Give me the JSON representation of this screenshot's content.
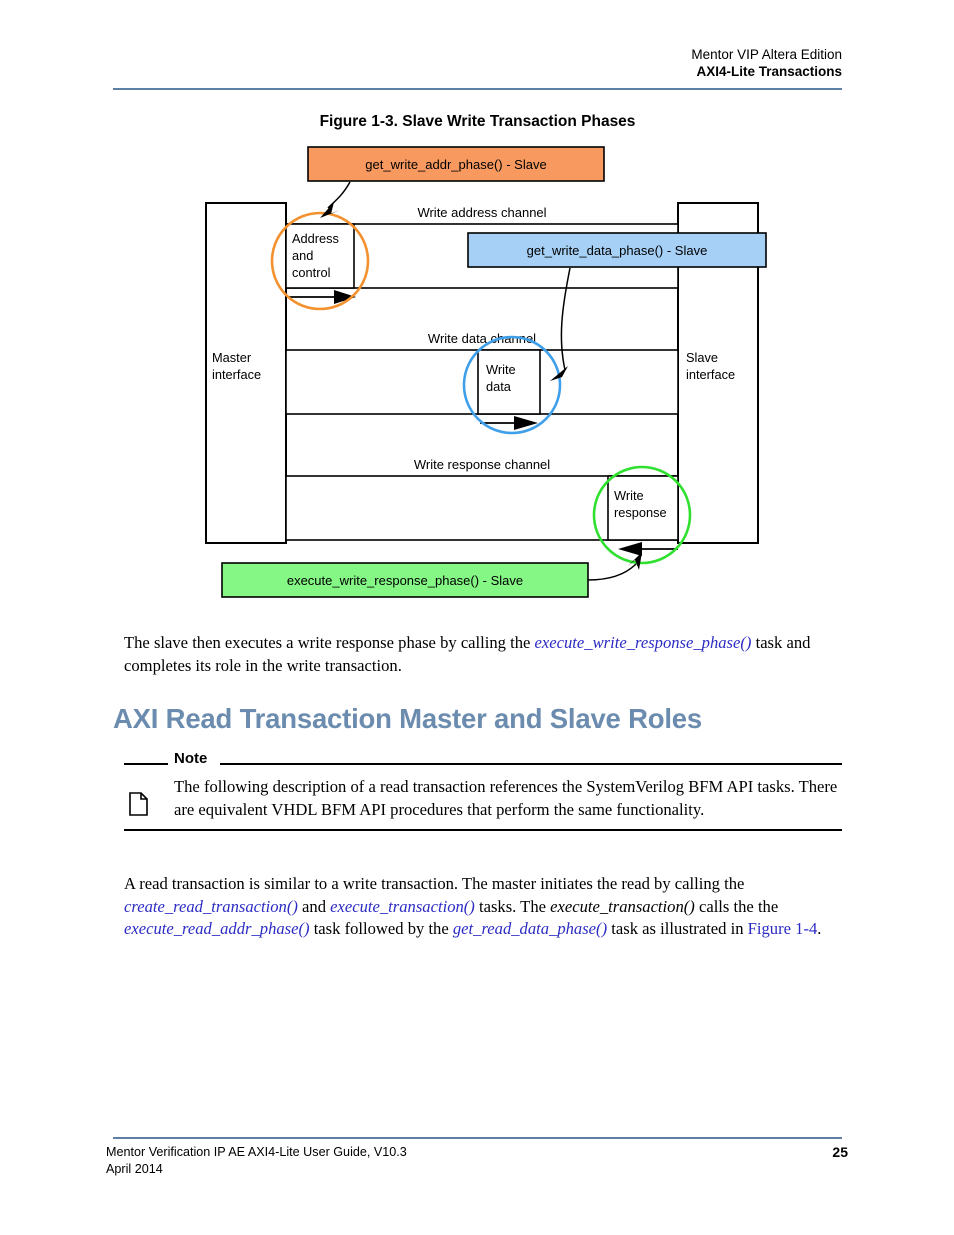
{
  "header": {
    "line1": "Mentor VIP Altera Edition",
    "line2": "AXI4-Lite Transactions",
    "rule_color": "#5c7fa3"
  },
  "figure": {
    "caption": "Figure 1-3. Slave Write Transaction Phases",
    "callouts": [
      {
        "id": "get-write-addr-phase",
        "label": "get_write_addr_phase() - Slave",
        "fill": "#f89a60",
        "stroke": "#000000"
      },
      {
        "id": "get-write-data-phase",
        "label": "get_write_data_phase() - Slave",
        "fill": "#a6d0f5",
        "stroke": "#000000"
      },
      {
        "id": "execute-write-response-phase",
        "label": "execute_write_response_phase() - Slave",
        "fill": "#85f785",
        "stroke": "#000000"
      }
    ],
    "master_interface": "Master\ninterface",
    "master_interface_line1": "Master",
    "master_interface_line2": "interface",
    "slave_interface_line1": "Slave",
    "slave_interface_line2": "interface",
    "channels": [
      {
        "id": "write-address-channel",
        "label": "Write address channel"
      },
      {
        "id": "write-data-channel",
        "label": "Write data channel"
      },
      {
        "id": "write-response-channel",
        "label": "Write response channel"
      }
    ],
    "payloads": [
      {
        "id": "address-and-control",
        "lines": [
          "Address",
          "and",
          "control"
        ],
        "highlight_color": "#f2912e"
      },
      {
        "id": "write-data",
        "lines": [
          "Write",
          "data"
        ],
        "highlight_color": "#3f9fe8"
      },
      {
        "id": "write-response",
        "lines": [
          "Write",
          "response"
        ],
        "highlight_color": "#2fe02f"
      }
    ]
  },
  "paragraph_slave_exec": {
    "part1": "The slave then executes a write response phase by calling the ",
    "link1": "execute_write_response_phase()",
    "part2": " task and completes its role in the write transaction."
  },
  "section": {
    "heading": "AXI Read Transaction Master and Slave Roles",
    "heading_color": "#6b8cae"
  },
  "note": {
    "label": "Note",
    "body": "The following description of a read transaction references the SystemVerilog BFM API tasks. There are equivalent VHDL BFM API procedures that perform the same functionality."
  },
  "paragraph_read_intro": {
    "part1": "A read transaction is similar to a write transaction. The master initiates the read by calling the ",
    "link1": "create_read_transaction()",
    "part2": " and ",
    "link2": "execute_transaction()",
    "part3": " tasks. The ",
    "emph1": "execute_transaction()",
    "part4": " calls the the ",
    "link3": "execute_read_addr_phase()",
    "part5": " task followed by the ",
    "link4": "get_read_data_phase()",
    "part6": " task as illustrated in ",
    "xref1": "Figure 1-4",
    "part7": "."
  },
  "footer": {
    "line1": "Mentor Verification IP AE AXI4-Lite User Guide, V10.3",
    "line2": "April 2014",
    "page_number": "25",
    "rule_color": "#5c7fa3"
  }
}
